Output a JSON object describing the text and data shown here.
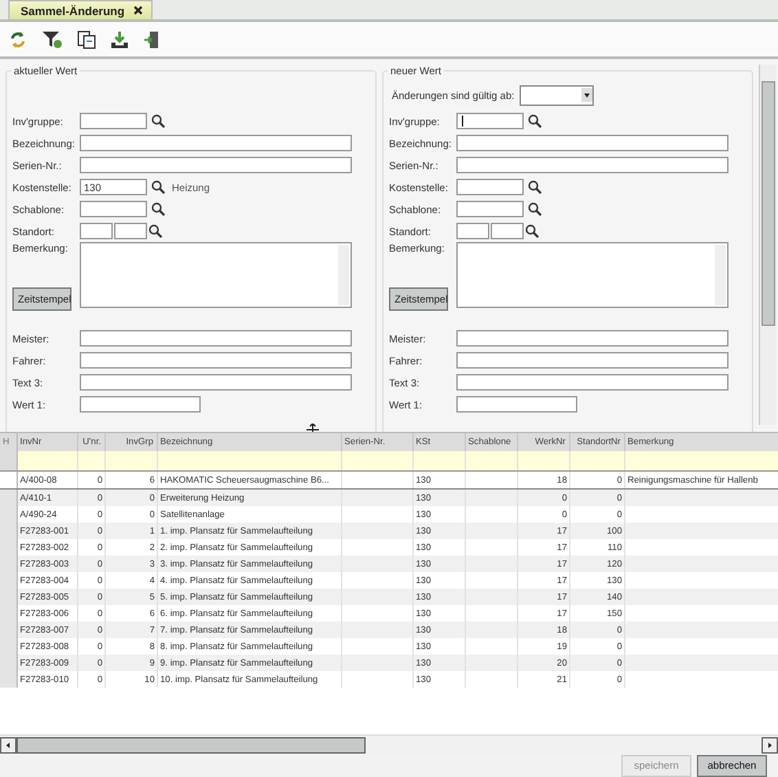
{
  "tab": {
    "title": "Sammel-Änderung",
    "selected": true
  },
  "panels": [
    {
      "title": "aktueller Wert",
      "fields": [
        {
          "kind": "short",
          "label": "Inv'gruppe:",
          "lookup": true,
          "focused": false
        },
        {
          "kind": "long",
          "label": "Bezeichnung:",
          "focused": false
        },
        {
          "kind": "long",
          "label": "Serien-Nr.:",
          "focused": false
        },
        {
          "kind": "short",
          "label": "Kostenstelle:",
          "value": "130",
          "lookup": true,
          "note": "Heizung",
          "focused": false
        },
        {
          "kind": "short",
          "label": "Schablone:",
          "lookup": true,
          "focused": false
        },
        {
          "kind": "double",
          "label": "Standort:",
          "lookup": true,
          "focused": false
        },
        {
          "kind": "memo",
          "label": "Bemerkung:",
          "button": "Zeitstempel",
          "focused": false
        },
        {
          "kind": "long",
          "label": "Meister:",
          "focused": false
        },
        {
          "kind": "long",
          "label": "Fahrer:",
          "focused": false
        },
        {
          "kind": "long",
          "label": "Text 3:",
          "focused": false
        },
        {
          "kind": "medium",
          "label": "Wert 1:",
          "focused": false
        }
      ]
    },
    {
      "title": "neuer Wert",
      "valid_from_label": "Änderungen sind gültig ab:",
      "fields": [
        {
          "kind": "short",
          "label": "Inv'gruppe:",
          "lookup": true,
          "focused": true
        },
        {
          "kind": "long",
          "label": "Bezeichnung:",
          "focused": false
        },
        {
          "kind": "long",
          "label": "Serien-Nr.:",
          "focused": false
        },
        {
          "kind": "short",
          "label": "Kostenstelle:",
          "lookup": true,
          "focused": false
        },
        {
          "kind": "short",
          "label": "Schablone:",
          "lookup": true,
          "focused": false
        },
        {
          "kind": "double",
          "label": "Standort:",
          "lookup": true,
          "focused": false
        },
        {
          "kind": "memo",
          "label": "Bemerkung:",
          "button": "Zeitstempel",
          "focused": false
        },
        {
          "kind": "long",
          "label": "Meister:",
          "focused": false
        },
        {
          "kind": "long",
          "label": "Fahrer:",
          "focused": false
        },
        {
          "kind": "long",
          "label": "Text 3:",
          "focused": false
        },
        {
          "kind": "medium",
          "label": "Wert 1:",
          "focused": false
        }
      ]
    }
  ],
  "table": {
    "corner": "H",
    "columns": [
      {
        "label": "InvNr"
      },
      {
        "label": "U'nr."
      },
      {
        "label": "InvGrp"
      },
      {
        "label": "Bezeichnung"
      },
      {
        "label": "Serien-Nr."
      },
      {
        "label": "KSt"
      },
      {
        "label": "Schablone"
      },
      {
        "label": "WerkNr"
      },
      {
        "label": "StandortNr"
      },
      {
        "label": "Bemerkung"
      }
    ],
    "rows": [
      {
        "selected": true,
        "cells": [
          "A/400-08",
          "0",
          "6",
          "HAKOMATIC Scheuersaugmaschine B6...",
          "",
          "130",
          "",
          "18",
          "0",
          "Reinigungsmaschine für Hallenb"
        ]
      },
      {
        "selected": false,
        "cells": [
          "A/410-1",
          "0",
          "0",
          "Erweiterung Heizung",
          "",
          "130",
          "",
          "0",
          "0",
          ""
        ]
      },
      {
        "selected": false,
        "cells": [
          "A/490-24",
          "0",
          "0",
          "Satellitenanlage",
          "",
          "130",
          "",
          "0",
          "0",
          ""
        ]
      },
      {
        "selected": false,
        "cells": [
          "F27283-001",
          "0",
          "1",
          "1. imp. Plansatz für Sammelaufteilung",
          "",
          "130",
          "",
          "17",
          "100",
          ""
        ]
      },
      {
        "selected": false,
        "cells": [
          "F27283-002",
          "0",
          "2",
          "2. imp. Plansatz für Sammelaufteilung",
          "",
          "130",
          "",
          "17",
          "110",
          ""
        ]
      },
      {
        "selected": false,
        "cells": [
          "F27283-003",
          "0",
          "3",
          "3. imp. Plansatz für Sammelaufteilung",
          "",
          "130",
          "",
          "17",
          "120",
          ""
        ]
      },
      {
        "selected": false,
        "cells": [
          "F27283-004",
          "0",
          "4",
          "4. imp. Plansatz für Sammelaufteilung",
          "",
          "130",
          "",
          "17",
          "130",
          ""
        ]
      },
      {
        "selected": false,
        "cells": [
          "F27283-005",
          "0",
          "5",
          "5. imp. Plansatz für Sammelaufteilung",
          "",
          "130",
          "",
          "17",
          "140",
          ""
        ]
      },
      {
        "selected": false,
        "cells": [
          "F27283-006",
          "0",
          "6",
          "6. imp. Plansatz für Sammelaufteilung",
          "",
          "130",
          "",
          "17",
          "150",
          ""
        ]
      },
      {
        "selected": false,
        "cells": [
          "F27283-007",
          "0",
          "7",
          "7. imp. Plansatz für Sammelaufteilung",
          "",
          "130",
          "",
          "18",
          "0",
          ""
        ]
      },
      {
        "selected": false,
        "cells": [
          "F27283-008",
          "0",
          "8",
          "8. imp. Plansatz für Sammelaufteilung",
          "",
          "130",
          "",
          "19",
          "0",
          ""
        ]
      },
      {
        "selected": false,
        "cells": [
          "F27283-009",
          "0",
          "9",
          "9. imp. Plansatz für Sammelaufteilung",
          "",
          "130",
          "",
          "20",
          "0",
          ""
        ]
      },
      {
        "selected": false,
        "cells": [
          "F27283-010",
          "0",
          "10",
          "10. imp. Plansatz für Sammelaufteilung",
          "",
          "130",
          "",
          "21",
          "0",
          ""
        ]
      }
    ]
  },
  "buttons": [
    {
      "label": "speichern",
      "disabled": true
    },
    {
      "label": "abbrechen",
      "disabled": false
    }
  ]
}
